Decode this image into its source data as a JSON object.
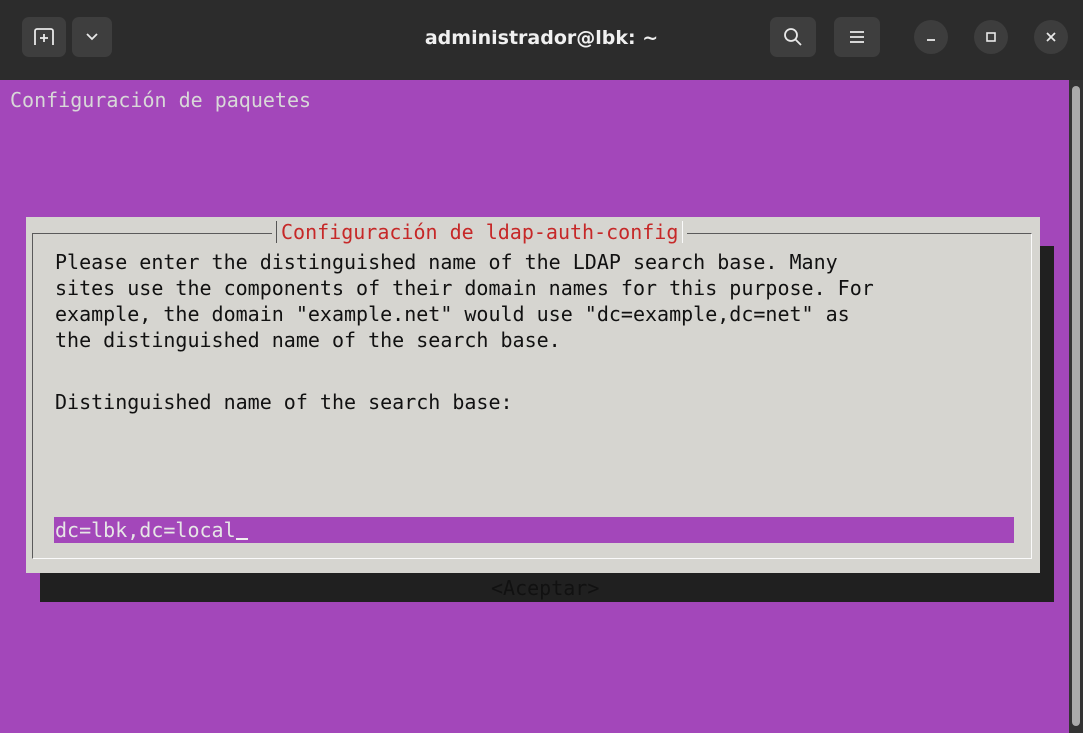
{
  "window": {
    "title": "administrador@lbk: ~",
    "buttons": [
      "new-tab-icon",
      "dropdown-icon",
      "search-icon",
      "menu-icon",
      "minimize-icon",
      "maximize-icon",
      "close-icon"
    ]
  },
  "terminal": {
    "header": "Configuración de paquetes",
    "background": "#a347ba"
  },
  "dialog": {
    "title": "Configuración de ldap-auth-config",
    "description": "Please enter the distinguished name of the LDAP search base. Many\nsites use the components of their domain names for this purpose. For\nexample, the domain \"example.net\" would use \"dc=example,dc=net\" as\nthe distinguished name of the search base.",
    "prompt": "Distinguished name of the search base:",
    "input_value": "dc=lbk,dc=local",
    "ok_label": "<Aceptar>"
  }
}
